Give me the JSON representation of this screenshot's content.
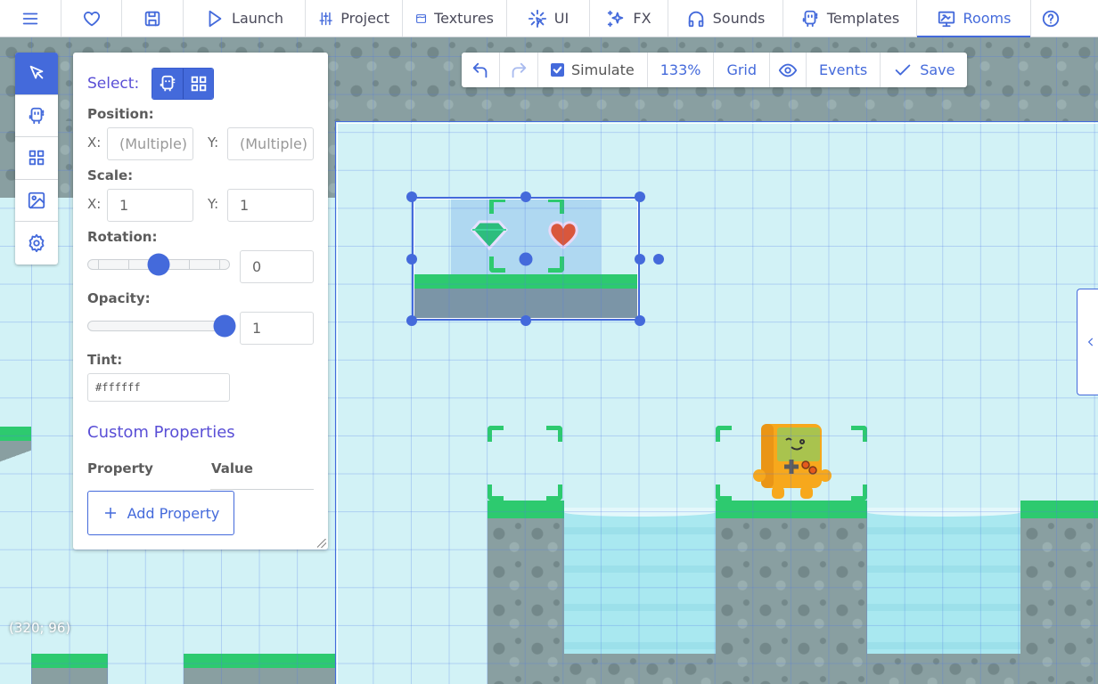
{
  "topnav": {
    "menu_icon": "hamburger-menu-icon",
    "items": [
      {
        "id": "favorite",
        "label": "",
        "icon": "heart-icon"
      },
      {
        "id": "save",
        "label": "",
        "icon": "floppy-disk-icon"
      },
      {
        "id": "launch",
        "label": "Launch",
        "icon": "play-icon"
      },
      {
        "id": "project",
        "label": "Project",
        "icon": "sliders-icon"
      },
      {
        "id": "textures",
        "label": "Textures",
        "icon": "texture-icon"
      },
      {
        "id": "ui",
        "label": "UI",
        "icon": "pointer-sparkle-icon"
      },
      {
        "id": "fx",
        "label": "FX",
        "icon": "sparkles-icon"
      },
      {
        "id": "sounds",
        "label": "Sounds",
        "icon": "headphones-icon"
      },
      {
        "id": "templates",
        "label": "Templates",
        "icon": "template-robot-icon"
      },
      {
        "id": "rooms",
        "label": "Rooms",
        "icon": "room-monitor-icon",
        "active": true
      }
    ],
    "help_icon": "help-icon"
  },
  "tool_rail": {
    "tools": [
      {
        "id": "select",
        "icon": "cursor-icon",
        "active": true
      },
      {
        "id": "copies",
        "icon": "template-robot-icon"
      },
      {
        "id": "tiles",
        "icon": "grid-icon"
      },
      {
        "id": "backgrounds",
        "icon": "image-icon"
      },
      {
        "id": "properties",
        "icon": "gear-icon"
      }
    ]
  },
  "properties": {
    "select_label": "Select:",
    "position_label": "Position:",
    "position": {
      "x_label": "X:",
      "x_placeholder": "(Multiple)",
      "y_label": "Y:",
      "y_placeholder": "(Multiple)"
    },
    "scale_label": "Scale:",
    "scale": {
      "x_label": "X:",
      "x_value": "1",
      "y_label": "Y:",
      "y_value": "1"
    },
    "rotation_label": "Rotation:",
    "rotation_value": "0",
    "rotation_slider_fraction": 0.5,
    "opacity_label": "Opacity:",
    "opacity_value": "1",
    "opacity_slider_fraction": 1.0,
    "tint_label": "Tint:",
    "tint_value": "#ffffff",
    "custom_properties_title": "Custom Properties",
    "col_property": "Property",
    "col_value": "Value",
    "add_property_label": "Add Property"
  },
  "room_toolbar": {
    "undo_icon": "undo-icon",
    "redo_icon": "redo-icon",
    "simulate_label": "Simulate",
    "simulate_checked": true,
    "zoom_label": "133%",
    "grid_label": "Grid",
    "visibility_icon": "eye-icon",
    "events_label": "Events",
    "save_label": "Save"
  },
  "status": {
    "cursor_coords": "(320; 96)"
  },
  "colors": {
    "accent": "#446adb",
    "heading": "#5a4fd6",
    "grass": "#2dca6f",
    "water": "#a9e8f0",
    "stone": "#899fa1",
    "sky": "#d2f2f6"
  }
}
